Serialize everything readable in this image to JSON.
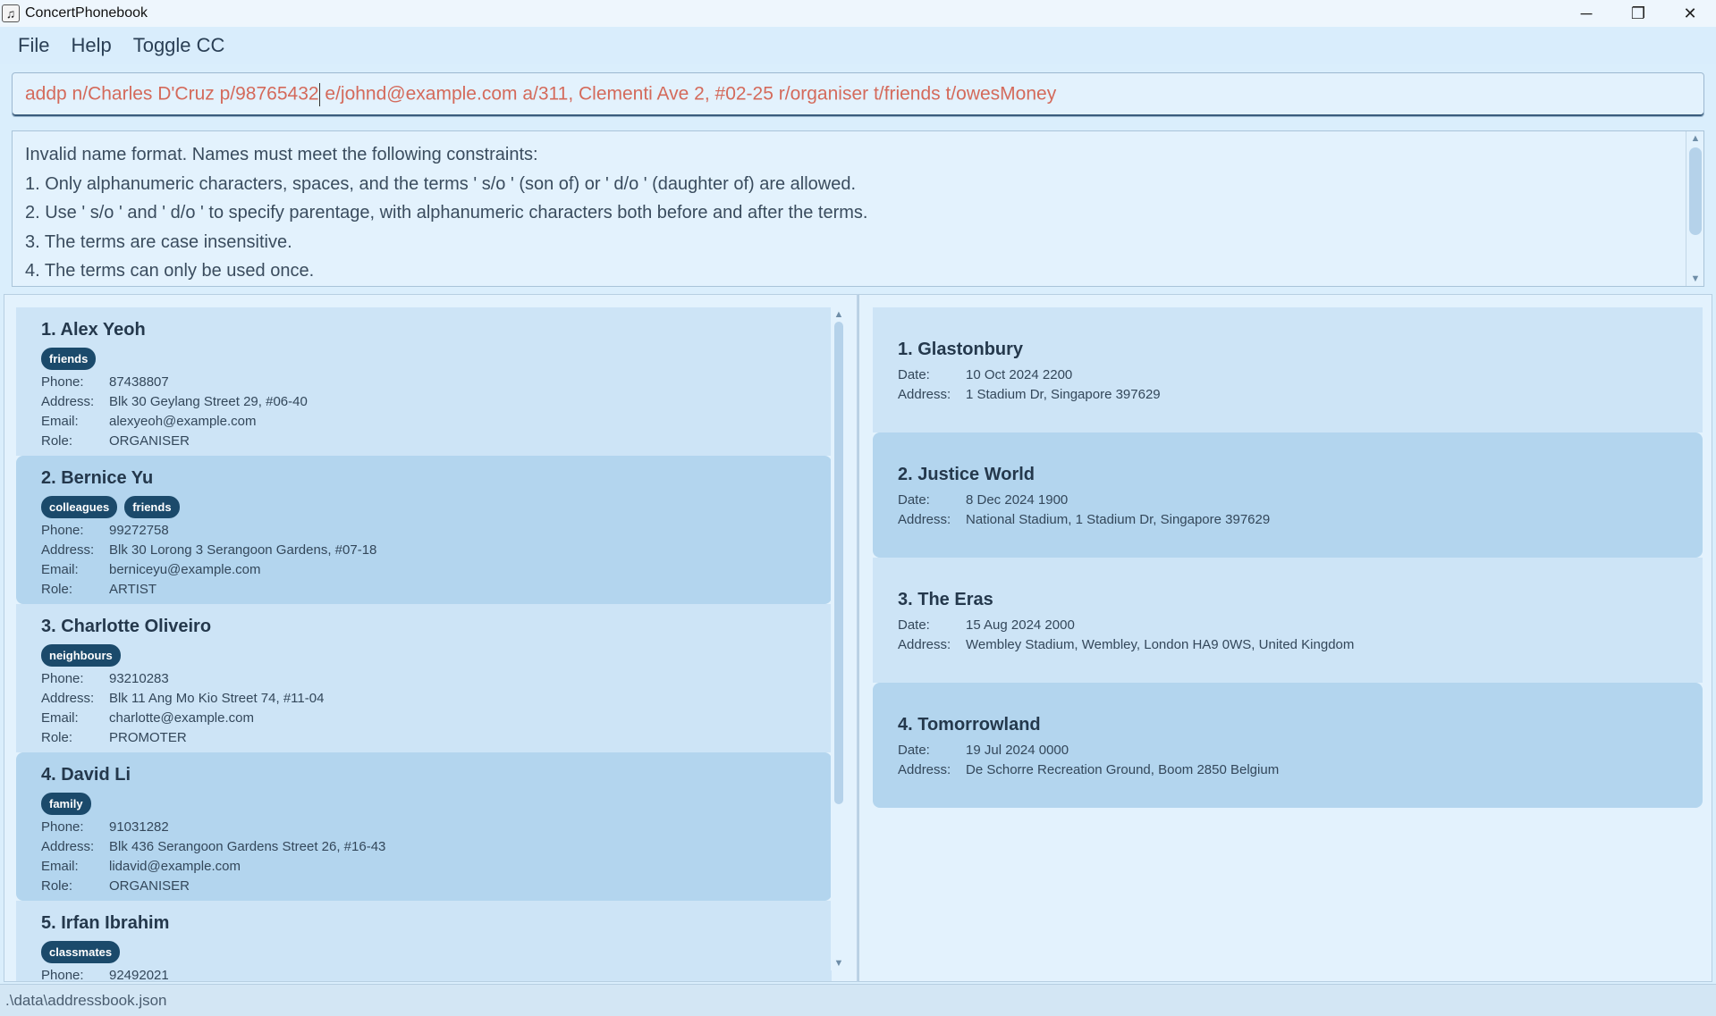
{
  "window": {
    "title": "ConcertPhonebook",
    "app_icon": "music-note-icon",
    "controls": {
      "minimize": "─",
      "restore": "❐",
      "close": "✕"
    }
  },
  "menu": {
    "items": [
      {
        "label": "File"
      },
      {
        "label": "Help"
      },
      {
        "label": "Toggle CC"
      }
    ]
  },
  "command": {
    "before_caret": "addp n/Charles D'Cruz p/98765432",
    "after_caret": " e/johnd@example.com a/311, Clementi Ave 2, #02-25 r/organiser t/friends t/owesMoney",
    "text_color": "#d46a5b"
  },
  "result": {
    "lines": [
      "Invalid name format. Names must meet the following constraints:",
      "1. Only alphanumeric characters, spaces, and the terms ' s/o ' (son of) or ' d/o ' (daughter of) are allowed.",
      "2. Use ' s/o ' and ' d/o ' to specify parentage, with alphanumeric characters both before and after the terms.",
      "3. The terms are case insensitive.",
      "4. The terms can only be used once."
    ]
  },
  "labels": {
    "phone": "Phone:",
    "address": "Address:",
    "email": "Email:",
    "role": "Role:",
    "date": "Date:"
  },
  "persons": [
    {
      "name": "1. Alex Yeoh",
      "tags": [
        "friends"
      ],
      "phone": "87438807",
      "address": "Blk 30 Geylang Street 29, #06-40",
      "email": "alexyeoh@example.com",
      "role": "ORGANISER"
    },
    {
      "name": "2. Bernice Yu",
      "tags": [
        "colleagues",
        "friends"
      ],
      "phone": "99272758",
      "address": "Blk 30 Lorong 3 Serangoon Gardens, #07-18",
      "email": "berniceyu@example.com",
      "role": "ARTIST"
    },
    {
      "name": "3. Charlotte Oliveiro",
      "tags": [
        "neighbours"
      ],
      "phone": "93210283",
      "address": "Blk 11 Ang Mo Kio Street 74, #11-04",
      "email": "charlotte@example.com",
      "role": "PROMOTER"
    },
    {
      "name": "4. David Li",
      "tags": [
        "family"
      ],
      "phone": "91031282",
      "address": "Blk 436 Serangoon Gardens Street 26, #16-43",
      "email": "lidavid@example.com",
      "role": "ORGANISER"
    },
    {
      "name": "5. Irfan Ibrahim",
      "tags": [
        "classmates"
      ],
      "phone": "92492021",
      "address": "",
      "email": "",
      "role": ""
    }
  ],
  "concerts": [
    {
      "name": "1. Glastonbury",
      "date": "10 Oct 2024 2200",
      "address": "1 Stadium Dr, Singapore 397629"
    },
    {
      "name": "2. Justice World",
      "date": "8 Dec 2024 1900",
      "address": "National Stadium, 1 Stadium Dr, Singapore 397629"
    },
    {
      "name": "3. The Eras",
      "date": "15 Aug 2024 2000",
      "address": "Wembley Stadium, Wembley, London HA9 0WS, United Kingdom"
    },
    {
      "name": "4. Tomorrowland",
      "date": "19 Jul 2024 0000",
      "address": "De Schorre Recreation Ground, Boom 2850 Belgium"
    }
  ],
  "status": {
    "path": ".\\data\\addressbook.json"
  },
  "colors": {
    "background": "#daeefc",
    "tag": "#1b4a6b",
    "card_light": "#cde4f6",
    "card_dark": "#b3d5ee"
  }
}
